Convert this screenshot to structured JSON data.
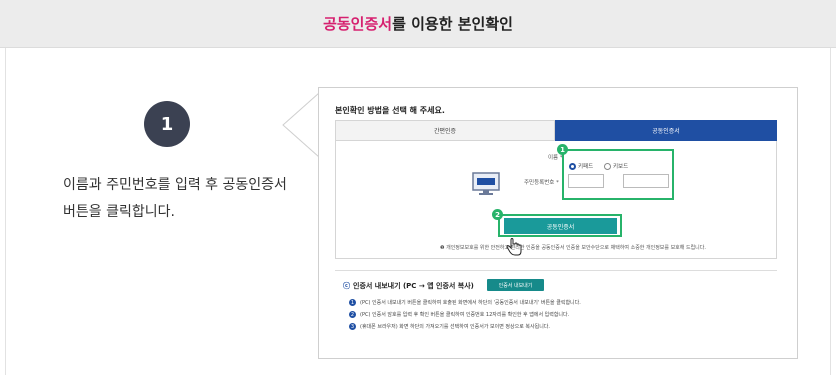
{
  "header": {
    "title_accent": "공동인증서",
    "title_rest": "를 이용한 본인확인"
  },
  "step": {
    "number": "1",
    "description_line1": "이름과 주민번호를 입력 후 공동인증서",
    "description_line2": "버튼을 클릭합니다."
  },
  "cert_panel": {
    "prompt": "본인확인 방법을 선택 해 주세요.",
    "tabs": [
      {
        "label": "간편인증",
        "active": false
      },
      {
        "label": "공동인증서",
        "active": true
      }
    ],
    "name_label": "이름 *",
    "rrn_label": "주민등록번호 *",
    "radio_options": [
      "키패드",
      "키보드"
    ],
    "cert_button_label": "공동인증서",
    "notice": "개인정보보호를 위한 안전하고 편리한 인증을 공동인증서 인증을 보안수단으로 채택하여 소중한 개인정보를 보호해 드립니다.",
    "marker_1": "1",
    "marker_2": "2"
  },
  "export": {
    "title": "인증서 내보내기 (PC → 앱 인증서 복사)",
    "button_label": "인증서 내보내기",
    "steps": [
      {
        "n": "1",
        "text": "(PC) 인증서 내보내기 버튼을 클릭하여 호출된 화면에서 하단의 '공동인증서 내보내기' 버튼을 클릭합니다."
      },
      {
        "n": "2",
        "text": "(PC) 인증서 암호를 입력 후 확인 버튼을 클릭하여 인증번호 12자리를 확인한 후 앱에서 입력합니다."
      },
      {
        "n": "3",
        "text": "(휴대폰 브라우저) 화면 하단의 가져오기를 선택하여 인증서가 보이면 정상으로 복사됩니다."
      }
    ]
  },
  "colors": {
    "accent": "#d6206f",
    "tab_active": "#1f4fa3",
    "button_teal": "#1a9a9a",
    "highlight_green": "#27b36a",
    "badge_dark": "#3b4152"
  }
}
